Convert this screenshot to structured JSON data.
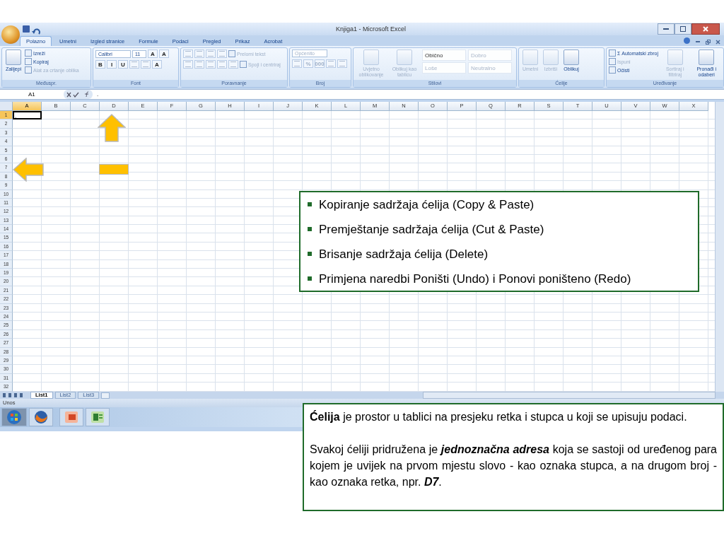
{
  "window": {
    "title": "Knjiga1 - Microsoft Excel"
  },
  "tabs": [
    {
      "label": "Polazno",
      "selected": true
    },
    {
      "label": "Umetni",
      "selected": false
    },
    {
      "label": "Izgled stranice",
      "selected": false
    },
    {
      "label": "Formule",
      "selected": false
    },
    {
      "label": "Podaci",
      "selected": false
    },
    {
      "label": "Pregled",
      "selected": false
    },
    {
      "label": "Prikaz",
      "selected": false
    },
    {
      "label": "Acrobat",
      "selected": false
    }
  ],
  "ribbon": [
    {
      "label": "Međuspr.",
      "kind": "columns",
      "items": [
        [
          {
            "kind": "large",
            "label": "Zalijepi",
            "disabled": false
          }
        ],
        [
          {
            "kind": "small",
            "label": "Izreži",
            "disabled": false
          },
          {
            "kind": "small",
            "label": "Kopiraj",
            "disabled": false
          },
          {
            "kind": "small",
            "label": "Alat za crtanje oblika",
            "disabled": true
          }
        ]
      ]
    },
    {
      "label": "Font",
      "kind": "rows",
      "items": [
        [
          {
            "kind": "field",
            "label": "Calibri",
            "disabled": false
          },
          {
            "kind": "field",
            "label": "11",
            "disabled": false
          },
          {
            "kind": "glyph",
            "label": "A",
            "disabled": false
          },
          {
            "kind": "glyph",
            "label": "A",
            "disabled": false
          }
        ],
        [
          {
            "kind": "glyph",
            "label": "B",
            "disabled": false
          },
          {
            "kind": "glyph",
            "label": "I",
            "disabled": false
          },
          {
            "kind": "glyph",
            "label": "U",
            "disabled": false
          },
          {
            "kind": "icon",
            "disabled": true
          },
          {
            "kind": "icon",
            "disabled": true
          },
          {
            "kind": "glyph",
            "label": "A",
            "disabled": false
          }
        ]
      ]
    },
    {
      "label": "Poravnanje",
      "kind": "rows",
      "items": [
        [
          {
            "kind": "icon",
            "disabled": true
          },
          {
            "kind": "icon",
            "disabled": true
          },
          {
            "kind": "icon",
            "disabled": true
          },
          {
            "kind": "icon",
            "disabled": true
          },
          {
            "kind": "small",
            "label": "Prelomi tekst",
            "disabled": true
          }
        ],
        [
          {
            "kind": "icon",
            "disabled": true
          },
          {
            "kind": "icon",
            "disabled": true
          },
          {
            "kind": "icon",
            "disabled": true
          },
          {
            "kind": "icon",
            "disabled": true
          },
          {
            "kind": "icon",
            "disabled": true
          },
          {
            "kind": "small",
            "label": "Spoji i centriraj",
            "disabled": true
          }
        ]
      ]
    },
    {
      "label": "Broj",
      "kind": "rows",
      "items": [
        [
          {
            "kind": "field",
            "label": "Općenito",
            "disabled": true
          }
        ],
        [
          {
            "kind": "icon",
            "disabled": true
          },
          {
            "kind": "glyph",
            "label": "%",
            "disabled": true
          },
          {
            "kind": "glyph",
            "label": "000",
            "disabled": true
          },
          {
            "kind": "icon",
            "disabled": true
          },
          {
            "kind": "icon",
            "disabled": true
          }
        ]
      ]
    },
    {
      "label": "Stilovi",
      "kind": "columns",
      "items": [
        [
          {
            "kind": "large",
            "label": "Uvjetno oblikovanje",
            "disabled": true
          }
        ],
        [
          {
            "kind": "large",
            "label": "Oblikuj kao tablicu",
            "disabled": true
          }
        ],
        [
          {
            "kind": "style",
            "label": "Obično",
            "disabled": false
          },
          {
            "kind": "style",
            "label": "Loše",
            "disabled": true
          }
        ],
        [
          {
            "kind": "style",
            "label": "Dobro",
            "disabled": true
          },
          {
            "kind": "style",
            "label": "Neutralno",
            "disabled": true
          }
        ]
      ]
    },
    {
      "label": "Ćelije",
      "kind": "columns",
      "items": [
        [
          {
            "kind": "large",
            "label": "Umetni",
            "disabled": true
          }
        ],
        [
          {
            "kind": "large",
            "label": "Izbriši",
            "disabled": true
          }
        ],
        [
          {
            "kind": "large",
            "label": "Oblikuj",
            "disabled": false
          }
        ]
      ]
    },
    {
      "label": "Uređivanje",
      "kind": "columns",
      "items": [
        [
          {
            "kind": "small",
            "label": "Σ Automatski zbroj",
            "disabled": false
          },
          {
            "kind": "small",
            "label": "Ispuni",
            "disabled": true
          },
          {
            "kind": "small",
            "label": "Očisti",
            "disabled": false
          }
        ],
        [
          {
            "kind": "large",
            "label": "Sortiraj i filtriraj",
            "disabled": true
          }
        ],
        [
          {
            "kind": "large",
            "label": "Pronađi i odaberi",
            "disabled": false
          }
        ]
      ]
    }
  ],
  "formula_bar": {
    "name_box": "A1",
    "content": "."
  },
  "columns": [
    {
      "label": "A",
      "selected": true
    },
    {
      "label": "B",
      "selected": false
    },
    {
      "label": "C",
      "selected": false
    },
    {
      "label": "D",
      "selected": false
    },
    {
      "label": "E",
      "selected": false
    },
    {
      "label": "F",
      "selected": false
    },
    {
      "label": "G",
      "selected": false
    },
    {
      "label": "H",
      "selected": false
    },
    {
      "label": "I",
      "selected": false
    },
    {
      "label": "J",
      "selected": false
    },
    {
      "label": "K",
      "selected": false
    },
    {
      "label": "L",
      "selected": false
    },
    {
      "label": "M",
      "selected": false
    },
    {
      "label": "N",
      "selected": false
    },
    {
      "label": "O",
      "selected": false
    },
    {
      "label": "P",
      "selected": false
    },
    {
      "label": "Q",
      "selected": false
    },
    {
      "label": "R",
      "selected": false
    },
    {
      "label": "S",
      "selected": false
    },
    {
      "label": "T",
      "selected": false
    },
    {
      "label": "U",
      "selected": false
    },
    {
      "label": "V",
      "selected": false
    },
    {
      "label": "W",
      "selected": false
    },
    {
      "label": "X",
      "selected": false
    }
  ],
  "rows": [
    {
      "label": "1",
      "selected": true
    },
    {
      "label": "2",
      "selected": false
    },
    {
      "label": "3",
      "selected": false
    },
    {
      "label": "4",
      "selected": false
    },
    {
      "label": "5",
      "selected": false
    },
    {
      "label": "6",
      "selected": false
    },
    {
      "label": "7",
      "selected": false
    },
    {
      "label": "8",
      "selected": false
    },
    {
      "label": "9",
      "selected": false
    },
    {
      "label": "10",
      "selected": false
    },
    {
      "label": "11",
      "selected": false
    },
    {
      "label": "12",
      "selected": false
    },
    {
      "label": "13",
      "selected": false
    },
    {
      "label": "14",
      "selected": false
    },
    {
      "label": "15",
      "selected": false
    },
    {
      "label": "16",
      "selected": false
    },
    {
      "label": "17",
      "selected": false
    },
    {
      "label": "18",
      "selected": false
    },
    {
      "label": "19",
      "selected": false
    },
    {
      "label": "20",
      "selected": false
    },
    {
      "label": "21",
      "selected": false
    },
    {
      "label": "22",
      "selected": false
    },
    {
      "label": "23",
      "selected": false
    },
    {
      "label": "24",
      "selected": false
    },
    {
      "label": "25",
      "selected": false
    },
    {
      "label": "26",
      "selected": false
    },
    {
      "label": "27",
      "selected": false
    },
    {
      "label": "28",
      "selected": false
    },
    {
      "label": "29",
      "selected": false
    },
    {
      "label": "30",
      "selected": false
    },
    {
      "label": "31",
      "selected": false
    },
    {
      "label": "32",
      "selected": false
    }
  ],
  "active_cell_value": ".",
  "sheet_tabs": [
    {
      "label": "List1",
      "selected": true
    },
    {
      "label": "List2",
      "selected": false
    },
    {
      "label": "List3",
      "selected": false
    }
  ],
  "status_bar": "Unos",
  "bullets": [
    "Kopiranje sadržaja ćelija (Copy & Paste)",
    "Premještanje sadržaja ćelija (Cut & Paste)",
    "Brisanje sadržaja ćelija (Delete)",
    "Primjena naredbi Poništi (Undo) i Ponovi poništeno (Redo)"
  ],
  "note": [
    "**Ćelija** je prostor u tablici na presjeku retka i stupca u koji se upisuju podaci.",
    "Svakoj ćeliji pridružena je *jednoznačna adresa* koja se sastoji od uređenog para kojem je uvijek na prvom mjestu slovo - kao oznaka stupca, a na drugom broj - kao oznaka retka, npr. *D7*."
  ]
}
